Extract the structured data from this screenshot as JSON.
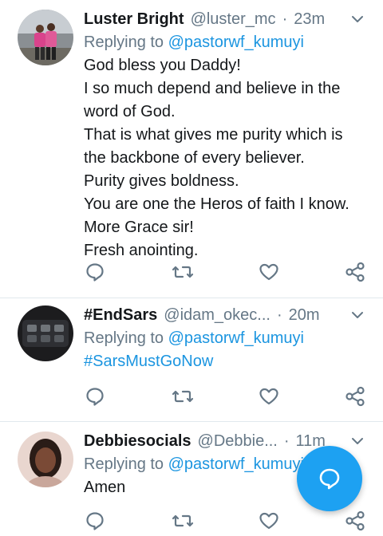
{
  "tweets": [
    {
      "name": "Luster Bright",
      "handle": "@luster_mc",
      "sep": "·",
      "time": "23m",
      "reply_prefix": "Replying to",
      "reply_to": "@pastorwf_kumuyi",
      "lines": [
        "God bless you Daddy!",
        "I so much depend and believe in the",
        "word of God.",
        "That is what gives me purity which is",
        "the backbone of every believer.",
        "Purity gives boldness.",
        "You are one the Heros of faith I know.",
        "More Grace sir!",
        "Fresh anointing."
      ]
    },
    {
      "name": "#EndSars",
      "handle": "@idam_okec...",
      "sep": "·",
      "time": "20m",
      "reply_prefix": "Replying to",
      "reply_to": "@pastorwf_kumuyi",
      "lines": [
        "#SarsMustGoNow"
      ]
    },
    {
      "name": "Debbiesocials",
      "handle": "@Debbie...",
      "sep": "·",
      "time": "11m",
      "reply_prefix": "Replying to",
      "reply_to": "@pastorwf_kumuyi",
      "lines": [
        "Amen"
      ]
    }
  ],
  "icons": {
    "reply": "reply-icon",
    "retweet": "retweet-icon",
    "like": "heart-icon",
    "share": "share-icon",
    "more": "chevron-down-icon",
    "compose": "compose-reply-icon"
  },
  "colors": {
    "accent": "#1da1f2",
    "link": "#1b95e0",
    "muted": "#657786",
    "text": "#14171a"
  }
}
